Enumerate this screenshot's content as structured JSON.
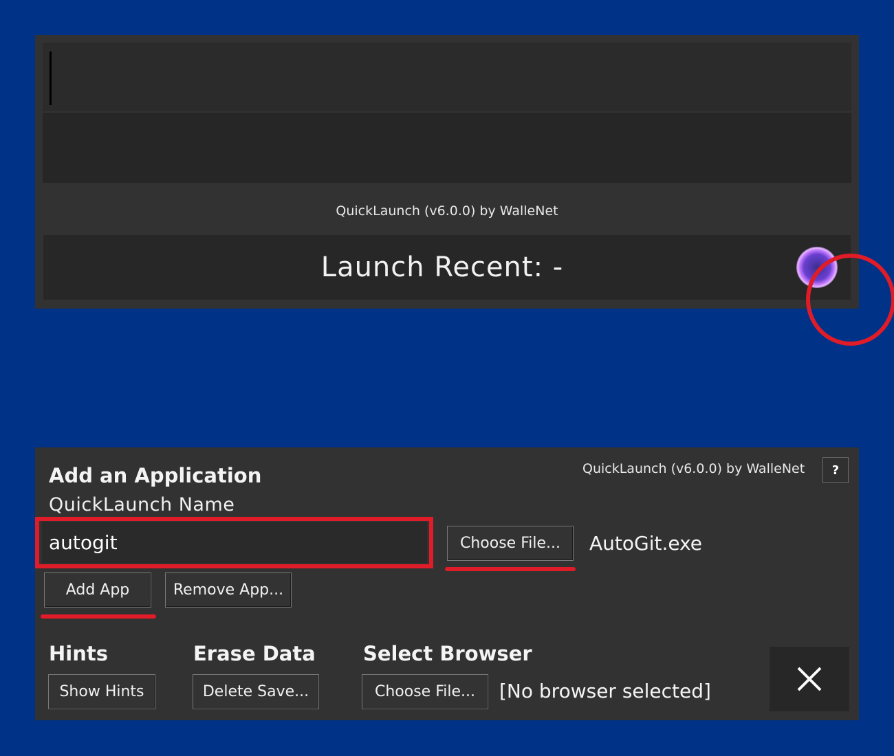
{
  "launcher": {
    "search_value": "",
    "credit": "QuickLaunch (v6.0.0) by WalleNet",
    "recent_label": "Launch Recent: -"
  },
  "manager": {
    "title": "Add an Application",
    "credit": "QuickLaunch (v6.0.0) by WalleNet",
    "help_label": "?",
    "name_label": "QuickLaunch Name",
    "name_value": "autogit",
    "choose_file_label": "Choose File...",
    "selected_file": "AutoGit.exe",
    "add_app_label": "Add App",
    "remove_app_label": "Remove App...",
    "hints_heading": "Hints",
    "show_hints_label": "Show Hints",
    "erase_heading": "Erase Data",
    "delete_save_label": "Delete Save...",
    "browser_heading": "Select Browser",
    "browser_choose_label": "Choose File...",
    "browser_status": "[No browser selected]"
  },
  "colors": {
    "background": "#003287",
    "panel": "#323232",
    "annotation": "#e01c28",
    "orb": "#c77cff"
  },
  "icons": [
    "orb-icon",
    "close-icon"
  ]
}
